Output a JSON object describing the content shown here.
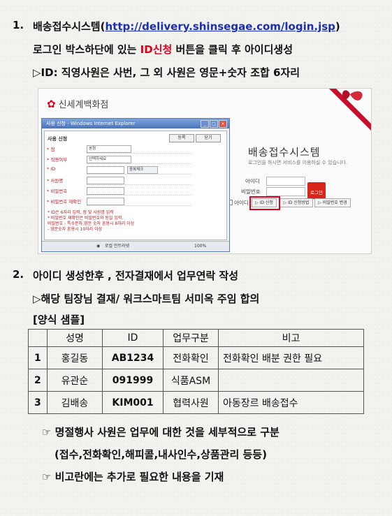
{
  "section1": {
    "number": "1.",
    "title_prefix": "배송접수시스템(",
    "url": "http://delivery.shinsegae.com/login.jsp",
    "title_suffix": ")",
    "line2_prefix": "로그인 박스하단에 있는 ",
    "line2_highlight": "ID신청",
    "line2_suffix": " 버튼을 클릭 후 아이디생성",
    "line3": "▷ID: 직영사원은 사번, 그 외 사원은 영문+숫자 조합 6자리"
  },
  "screenshot": {
    "logo_text": "신세계백화점",
    "system_title": "배송접수시스템",
    "system_subtitle": "로그인을 하시면 서비스를 이용하실 수 있습니다.",
    "id_label": "아이디",
    "pw_label": "비밀번호",
    "login_button": "로그인",
    "remember_label": "아이디",
    "id_request_button": "▷ ID 신청",
    "id_method_button": "▷ ID 신청방법",
    "pw_change_button": "▷ 비밀번호 변경",
    "popup": {
      "window_title": "사용 신청 - Windows Internet Explorer",
      "form_title": "사용 신청",
      "register_button": "등록",
      "close_button": "닫기",
      "fields": [
        {
          "label": "* 점",
          "value": "본점"
        },
        {
          "label": "* 직영여부",
          "value": "선택하세요"
        },
        {
          "label": "* ID",
          "value": ""
        },
        {
          "label": "* 사원명",
          "value": ""
        },
        {
          "label": "* 비밀번호",
          "value": ""
        },
        {
          "label": "* 비밀번호 재확인",
          "value": ""
        }
      ],
      "dup_check_button": "중복체크",
      "notes": [
        "* ID은 6자리 입력, 점 및 사원명 입력",
        "* 비밀번호 재확인은 비밀번호와 동일 입력.",
        "  비밀번호 - 특수문자,영문 숫자 혼용시 8자리 이상",
        "        - 영문숫자 혼용시 10자리 이상"
      ],
      "status_zone": "로컬 인트라넷",
      "zoom": "100%"
    }
  },
  "section2": {
    "number": "2.",
    "title": "아이디 생성한후 , 전자결재에서 업무연락 작성",
    "sub": "▷해당 팀장님 결재/ 워크스마트팀 서미옥 주임 합의",
    "sample_label": "[양식 샘플]"
  },
  "table": {
    "headers": [
      "",
      "성명",
      "ID",
      "업무구분",
      "비고"
    ],
    "rows": [
      {
        "no": "1",
        "name": "홍길동",
        "id": "AB1234",
        "task": "전화확인",
        "note": "전화확인 배분 권한 필요"
      },
      {
        "no": "2",
        "name": "유관순",
        "id": "091999",
        "task": "식품ASM",
        "note": ""
      },
      {
        "no": "3",
        "name": "김배송",
        "id": "KIM001",
        "task": "협력사원",
        "note": "아동장르 배송접수"
      }
    ]
  },
  "notes": {
    "note1": "☞ 명절행사 사원은  업무에 대한 것을 세부적으로 구분",
    "note1_detail": "(접수,전화확인,해피콜,내사인수,상품관리 등등)",
    "note2": "☞ 비고란에는 추가로 필요한 내용을 기재"
  }
}
